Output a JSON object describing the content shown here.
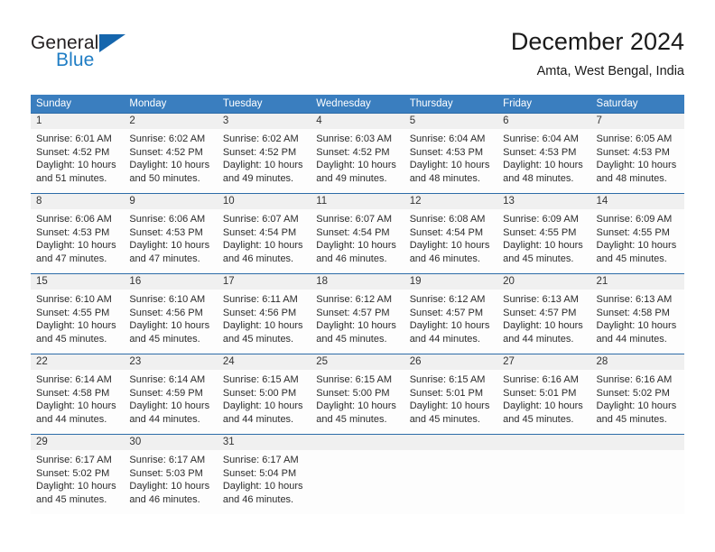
{
  "brand": {
    "name_part1": "General",
    "name_part2": "Blue",
    "flag_icon": "triangle-flag-icon",
    "accent_color": "#1f7dc4"
  },
  "header": {
    "title": "December 2024",
    "subtitle": "Amta, West Bengal, India"
  },
  "theme": {
    "header_row_bg": "#3a7ebf",
    "daynum_strip_bg": "#f0f0f0",
    "rule_color": "#2d6ca8",
    "text_color": "#2b2b2b"
  },
  "weekdays": [
    "Sunday",
    "Monday",
    "Tuesday",
    "Wednesday",
    "Thursday",
    "Friday",
    "Saturday"
  ],
  "weeks": [
    {
      "days": [
        {
          "num": "1",
          "sunrise": "Sunrise: 6:01 AM",
          "sunset": "Sunset: 4:52 PM",
          "daylight": "Daylight: 10 hours and 51 minutes."
        },
        {
          "num": "2",
          "sunrise": "Sunrise: 6:02 AM",
          "sunset": "Sunset: 4:52 PM",
          "daylight": "Daylight: 10 hours and 50 minutes."
        },
        {
          "num": "3",
          "sunrise": "Sunrise: 6:02 AM",
          "sunset": "Sunset: 4:52 PM",
          "daylight": "Daylight: 10 hours and 49 minutes."
        },
        {
          "num": "4",
          "sunrise": "Sunrise: 6:03 AM",
          "sunset": "Sunset: 4:52 PM",
          "daylight": "Daylight: 10 hours and 49 minutes."
        },
        {
          "num": "5",
          "sunrise": "Sunrise: 6:04 AM",
          "sunset": "Sunset: 4:53 PM",
          "daylight": "Daylight: 10 hours and 48 minutes."
        },
        {
          "num": "6",
          "sunrise": "Sunrise: 6:04 AM",
          "sunset": "Sunset: 4:53 PM",
          "daylight": "Daylight: 10 hours and 48 minutes."
        },
        {
          "num": "7",
          "sunrise": "Sunrise: 6:05 AM",
          "sunset": "Sunset: 4:53 PM",
          "daylight": "Daylight: 10 hours and 48 minutes."
        }
      ]
    },
    {
      "days": [
        {
          "num": "8",
          "sunrise": "Sunrise: 6:06 AM",
          "sunset": "Sunset: 4:53 PM",
          "daylight": "Daylight: 10 hours and 47 minutes."
        },
        {
          "num": "9",
          "sunrise": "Sunrise: 6:06 AM",
          "sunset": "Sunset: 4:53 PM",
          "daylight": "Daylight: 10 hours and 47 minutes."
        },
        {
          "num": "10",
          "sunrise": "Sunrise: 6:07 AM",
          "sunset": "Sunset: 4:54 PM",
          "daylight": "Daylight: 10 hours and 46 minutes."
        },
        {
          "num": "11",
          "sunrise": "Sunrise: 6:07 AM",
          "sunset": "Sunset: 4:54 PM",
          "daylight": "Daylight: 10 hours and 46 minutes."
        },
        {
          "num": "12",
          "sunrise": "Sunrise: 6:08 AM",
          "sunset": "Sunset: 4:54 PM",
          "daylight": "Daylight: 10 hours and 46 minutes."
        },
        {
          "num": "13",
          "sunrise": "Sunrise: 6:09 AM",
          "sunset": "Sunset: 4:55 PM",
          "daylight": "Daylight: 10 hours and 45 minutes."
        },
        {
          "num": "14",
          "sunrise": "Sunrise: 6:09 AM",
          "sunset": "Sunset: 4:55 PM",
          "daylight": "Daylight: 10 hours and 45 minutes."
        }
      ]
    },
    {
      "days": [
        {
          "num": "15",
          "sunrise": "Sunrise: 6:10 AM",
          "sunset": "Sunset: 4:55 PM",
          "daylight": "Daylight: 10 hours and 45 minutes."
        },
        {
          "num": "16",
          "sunrise": "Sunrise: 6:10 AM",
          "sunset": "Sunset: 4:56 PM",
          "daylight": "Daylight: 10 hours and 45 minutes."
        },
        {
          "num": "17",
          "sunrise": "Sunrise: 6:11 AM",
          "sunset": "Sunset: 4:56 PM",
          "daylight": "Daylight: 10 hours and 45 minutes."
        },
        {
          "num": "18",
          "sunrise": "Sunrise: 6:12 AM",
          "sunset": "Sunset: 4:57 PM",
          "daylight": "Daylight: 10 hours and 45 minutes."
        },
        {
          "num": "19",
          "sunrise": "Sunrise: 6:12 AM",
          "sunset": "Sunset: 4:57 PM",
          "daylight": "Daylight: 10 hours and 44 minutes."
        },
        {
          "num": "20",
          "sunrise": "Sunrise: 6:13 AM",
          "sunset": "Sunset: 4:57 PM",
          "daylight": "Daylight: 10 hours and 44 minutes."
        },
        {
          "num": "21",
          "sunrise": "Sunrise: 6:13 AM",
          "sunset": "Sunset: 4:58 PM",
          "daylight": "Daylight: 10 hours and 44 minutes."
        }
      ]
    },
    {
      "days": [
        {
          "num": "22",
          "sunrise": "Sunrise: 6:14 AM",
          "sunset": "Sunset: 4:58 PM",
          "daylight": "Daylight: 10 hours and 44 minutes."
        },
        {
          "num": "23",
          "sunrise": "Sunrise: 6:14 AM",
          "sunset": "Sunset: 4:59 PM",
          "daylight": "Daylight: 10 hours and 44 minutes."
        },
        {
          "num": "24",
          "sunrise": "Sunrise: 6:15 AM",
          "sunset": "Sunset: 5:00 PM",
          "daylight": "Daylight: 10 hours and 44 minutes."
        },
        {
          "num": "25",
          "sunrise": "Sunrise: 6:15 AM",
          "sunset": "Sunset: 5:00 PM",
          "daylight": "Daylight: 10 hours and 45 minutes."
        },
        {
          "num": "26",
          "sunrise": "Sunrise: 6:15 AM",
          "sunset": "Sunset: 5:01 PM",
          "daylight": "Daylight: 10 hours and 45 minutes."
        },
        {
          "num": "27",
          "sunrise": "Sunrise: 6:16 AM",
          "sunset": "Sunset: 5:01 PM",
          "daylight": "Daylight: 10 hours and 45 minutes."
        },
        {
          "num": "28",
          "sunrise": "Sunrise: 6:16 AM",
          "sunset": "Sunset: 5:02 PM",
          "daylight": "Daylight: 10 hours and 45 minutes."
        }
      ]
    },
    {
      "days": [
        {
          "num": "29",
          "sunrise": "Sunrise: 6:17 AM",
          "sunset": "Sunset: 5:02 PM",
          "daylight": "Daylight: 10 hours and 45 minutes."
        },
        {
          "num": "30",
          "sunrise": "Sunrise: 6:17 AM",
          "sunset": "Sunset: 5:03 PM",
          "daylight": "Daylight: 10 hours and 46 minutes."
        },
        {
          "num": "31",
          "sunrise": "Sunrise: 6:17 AM",
          "sunset": "Sunset: 5:04 PM",
          "daylight": "Daylight: 10 hours and 46 minutes."
        },
        {
          "num": "",
          "sunrise": "",
          "sunset": "",
          "daylight": ""
        },
        {
          "num": "",
          "sunrise": "",
          "sunset": "",
          "daylight": ""
        },
        {
          "num": "",
          "sunrise": "",
          "sunset": "",
          "daylight": ""
        },
        {
          "num": "",
          "sunrise": "",
          "sunset": "",
          "daylight": ""
        }
      ]
    }
  ]
}
